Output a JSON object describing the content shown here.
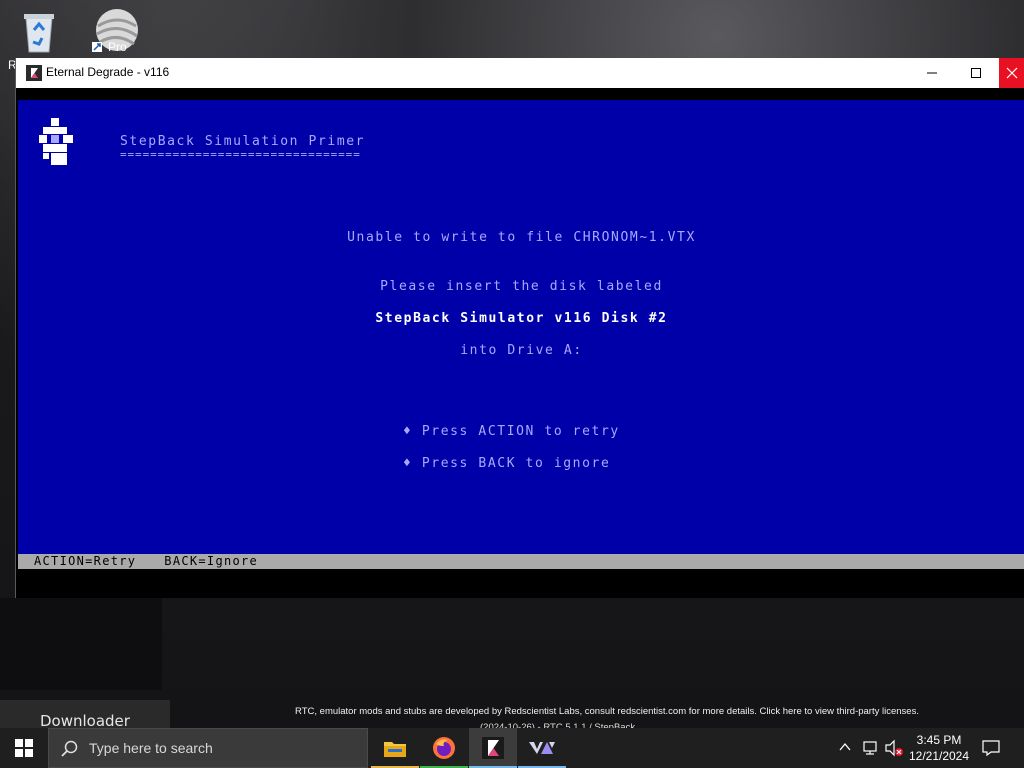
{
  "desktop": {
    "icons": [
      {
        "name": "recycle-bin",
        "label_fragment": "R"
      },
      {
        "name": "globe-pro",
        "badge": "Pro"
      }
    ],
    "downloader_label": "Downloader",
    "notice_line1": "RTC, emulator mods and stubs are developed by Redscientist Labs, consult redscientist.com for more details. Click here to view third-party licenses.",
    "notice_line2": "(2024-10-26) - RTC 5.1.1 / StepBack ..."
  },
  "window": {
    "title": "Eternal Degrade - v116",
    "minimize_label": "—",
    "maximize_label": "☐",
    "close_label": "✕"
  },
  "emulator": {
    "heading": "StepBack Simulation Primer",
    "heading_underline": "================================",
    "message_unable": "Unable to write to file CHRONOM~1.VTX",
    "message_insert": "Please insert the disk labeled",
    "disk_label": "StepBack Simulator v116 Disk #2",
    "message_drive": "into Drive A:",
    "option_retry": "♦ Press ACTION to retry",
    "option_ignore": "♦ Press BACK to ignore",
    "status_retry": "ACTION=Retry",
    "status_ignore": "BACK=Ignore"
  },
  "taskbar": {
    "search_placeholder": "Type here to search",
    "apps": [
      "file-explorer",
      "firefox",
      "eternal-degrade",
      "vortex"
    ],
    "clock_time": "3:45 PM",
    "clock_date": "12/21/2024"
  },
  "colors": {
    "dos_background": "#0000a8",
    "dos_text": "#a8a8ff",
    "dos_highlight": "#ffffff",
    "statusbar_bg": "#aaaaaa",
    "taskbar_bg": "#1f1f1f",
    "close_button": "#e81123"
  }
}
